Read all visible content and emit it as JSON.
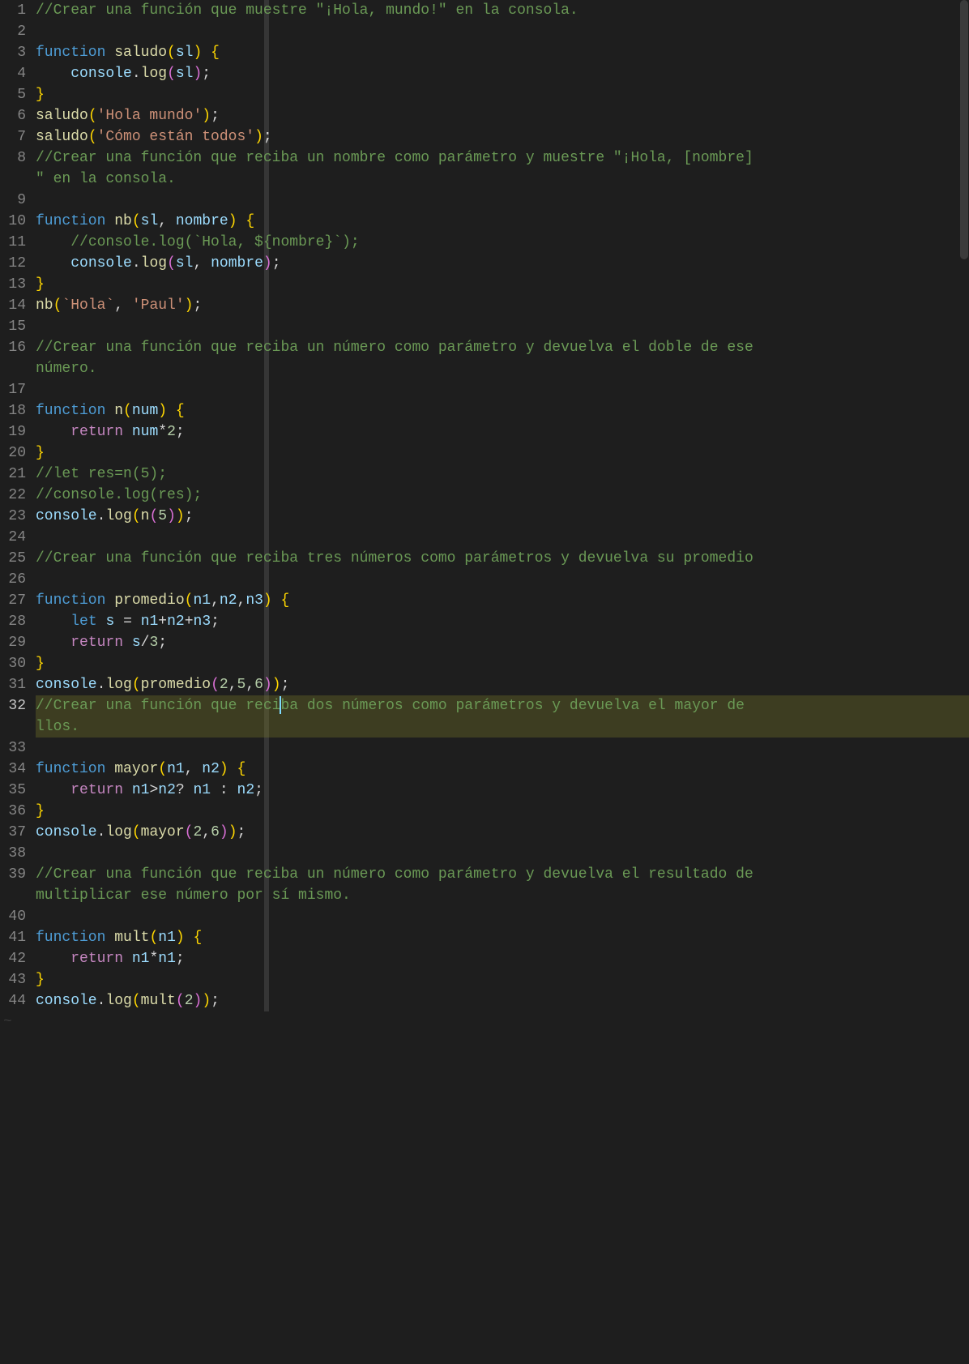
{
  "editor": {
    "activeLine": 32,
    "lines": [
      {
        "n": 1,
        "tokens": [
          [
            "comment",
            "//Crear una función que muestre \"¡Hola, mundo!\" en la consola."
          ]
        ]
      },
      {
        "n": 2,
        "tokens": []
      },
      {
        "n": 3,
        "tokens": [
          [
            "storage",
            "function"
          ],
          [
            "punc",
            " "
          ],
          [
            "func",
            "saludo"
          ],
          [
            "brace",
            "("
          ],
          [
            "param",
            "sl"
          ],
          [
            "brace",
            ")"
          ],
          [
            "punc",
            " "
          ],
          [
            "brace",
            "{"
          ]
        ]
      },
      {
        "n": 4,
        "tokens": [
          [
            "punc",
            "    "
          ],
          [
            "var",
            "console"
          ],
          [
            "punc",
            "."
          ],
          [
            "func",
            "log"
          ],
          [
            "brace2",
            "("
          ],
          [
            "var",
            "sl"
          ],
          [
            "brace2",
            ")"
          ],
          [
            "punc",
            ";"
          ]
        ]
      },
      {
        "n": 5,
        "tokens": [
          [
            "brace",
            "}"
          ]
        ]
      },
      {
        "n": 6,
        "tokens": [
          [
            "func",
            "saludo"
          ],
          [
            "brace",
            "("
          ],
          [
            "string",
            "'Hola mundo'"
          ],
          [
            "brace",
            ")"
          ],
          [
            "punc",
            ";"
          ]
        ]
      },
      {
        "n": 7,
        "tokens": [
          [
            "func",
            "saludo"
          ],
          [
            "brace",
            "("
          ],
          [
            "string",
            "'Cómo están todos'"
          ],
          [
            "brace",
            ")"
          ],
          [
            "punc",
            ";"
          ]
        ]
      },
      {
        "n": 8,
        "tokens": [
          [
            "comment",
            "//Crear una función que reciba un nombre como parámetro y muestre \"¡Hola, [nombre]"
          ]
        ]
      },
      {
        "n": 8,
        "wrap": true,
        "tokens": [
          [
            "comment",
            "\" en la consola."
          ]
        ]
      },
      {
        "n": 9,
        "tokens": []
      },
      {
        "n": 10,
        "tokens": [
          [
            "storage",
            "function"
          ],
          [
            "punc",
            " "
          ],
          [
            "func",
            "nb"
          ],
          [
            "brace",
            "("
          ],
          [
            "param",
            "sl"
          ],
          [
            "punc",
            ", "
          ],
          [
            "param",
            "nombre"
          ],
          [
            "brace",
            ")"
          ],
          [
            "punc",
            " "
          ],
          [
            "brace",
            "{"
          ]
        ]
      },
      {
        "n": 11,
        "tokens": [
          [
            "punc",
            "    "
          ],
          [
            "comment",
            "//console.log(`Hola, ${nombre}`);"
          ]
        ]
      },
      {
        "n": 12,
        "tokens": [
          [
            "punc",
            "    "
          ],
          [
            "var",
            "console"
          ],
          [
            "punc",
            "."
          ],
          [
            "func",
            "log"
          ],
          [
            "brace2",
            "("
          ],
          [
            "var",
            "sl"
          ],
          [
            "punc",
            ", "
          ],
          [
            "var",
            "nombre"
          ],
          [
            "brace2",
            ")"
          ],
          [
            "punc",
            ";"
          ]
        ]
      },
      {
        "n": 13,
        "tokens": [
          [
            "brace",
            "}"
          ]
        ]
      },
      {
        "n": 14,
        "tokens": [
          [
            "func",
            "nb"
          ],
          [
            "brace",
            "("
          ],
          [
            "string",
            "`Hola`"
          ],
          [
            "punc",
            ", "
          ],
          [
            "string",
            "'Paul'"
          ],
          [
            "brace",
            ")"
          ],
          [
            "punc",
            ";"
          ]
        ]
      },
      {
        "n": 15,
        "tokens": []
      },
      {
        "n": 16,
        "tokens": [
          [
            "comment",
            "//Crear una función que reciba un número como parámetro y devuelva el doble de ese"
          ]
        ]
      },
      {
        "n": 16,
        "wrap": true,
        "tokens": [
          [
            "comment",
            "número."
          ]
        ]
      },
      {
        "n": 17,
        "tokens": []
      },
      {
        "n": 18,
        "tokens": [
          [
            "storage",
            "function"
          ],
          [
            "punc",
            " "
          ],
          [
            "func",
            "n"
          ],
          [
            "brace",
            "("
          ],
          [
            "param",
            "num"
          ],
          [
            "brace",
            ")"
          ],
          [
            "punc",
            " "
          ],
          [
            "brace",
            "{"
          ]
        ]
      },
      {
        "n": 19,
        "tokens": [
          [
            "punc",
            "    "
          ],
          [
            "keyword",
            "return"
          ],
          [
            "punc",
            " "
          ],
          [
            "var",
            "num"
          ],
          [
            "op",
            "*"
          ],
          [
            "number",
            "2"
          ],
          [
            "punc",
            ";"
          ]
        ]
      },
      {
        "n": 20,
        "tokens": [
          [
            "brace",
            "}"
          ]
        ]
      },
      {
        "n": 21,
        "tokens": [
          [
            "comment",
            "//let res=n(5);"
          ]
        ]
      },
      {
        "n": 22,
        "tokens": [
          [
            "comment",
            "//console.log(res);"
          ]
        ]
      },
      {
        "n": 23,
        "tokens": [
          [
            "var",
            "console"
          ],
          [
            "punc",
            "."
          ],
          [
            "func",
            "log"
          ],
          [
            "brace",
            "("
          ],
          [
            "func",
            "n"
          ],
          [
            "brace2",
            "("
          ],
          [
            "number",
            "5"
          ],
          [
            "brace2",
            ")"
          ],
          [
            "brace",
            ")"
          ],
          [
            "punc",
            ";"
          ]
        ]
      },
      {
        "n": 24,
        "tokens": []
      },
      {
        "n": 25,
        "tokens": [
          [
            "comment",
            "//Crear una función que reciba tres números como parámetros y devuelva su promedio"
          ]
        ]
      },
      {
        "n": 26,
        "tokens": []
      },
      {
        "n": 27,
        "tokens": [
          [
            "storage",
            "function"
          ],
          [
            "punc",
            " "
          ],
          [
            "func",
            "promedio"
          ],
          [
            "brace",
            "("
          ],
          [
            "param",
            "n1"
          ],
          [
            "punc",
            ","
          ],
          [
            "param",
            "n2"
          ],
          [
            "punc",
            ","
          ],
          [
            "param",
            "n3"
          ],
          [
            "brace",
            ")"
          ],
          [
            "punc",
            " "
          ],
          [
            "brace",
            "{"
          ]
        ]
      },
      {
        "n": 28,
        "tokens": [
          [
            "punc",
            "    "
          ],
          [
            "storage",
            "let"
          ],
          [
            "punc",
            " "
          ],
          [
            "var",
            "s"
          ],
          [
            "punc",
            " "
          ],
          [
            "op",
            "="
          ],
          [
            "punc",
            " "
          ],
          [
            "var",
            "n1"
          ],
          [
            "op",
            "+"
          ],
          [
            "var",
            "n2"
          ],
          [
            "op",
            "+"
          ],
          [
            "var",
            "n3"
          ],
          [
            "punc",
            ";"
          ]
        ]
      },
      {
        "n": 29,
        "tokens": [
          [
            "punc",
            "    "
          ],
          [
            "keyword",
            "return"
          ],
          [
            "punc",
            " "
          ],
          [
            "var",
            "s"
          ],
          [
            "op",
            "/"
          ],
          [
            "number",
            "3"
          ],
          [
            "punc",
            ";"
          ]
        ]
      },
      {
        "n": 30,
        "tokens": [
          [
            "brace",
            "}"
          ]
        ]
      },
      {
        "n": 31,
        "tokens": [
          [
            "var",
            "console"
          ],
          [
            "punc",
            "."
          ],
          [
            "func",
            "log"
          ],
          [
            "brace",
            "("
          ],
          [
            "func",
            "promedio"
          ],
          [
            "brace2",
            "("
          ],
          [
            "number",
            "2"
          ],
          [
            "punc",
            ","
          ],
          [
            "number",
            "5"
          ],
          [
            "punc",
            ","
          ],
          [
            "number",
            "6"
          ],
          [
            "brace2",
            ")"
          ],
          [
            "brace",
            ")"
          ],
          [
            "punc",
            ";"
          ]
        ]
      },
      {
        "n": 32,
        "highlight": true,
        "cursorAfterToken": 0,
        "cursorInText": 28,
        "tokens": [
          [
            "comment",
            "//Crear una función que reciba dos números como parámetros y devuelva el mayor de "
          ]
        ]
      },
      {
        "n": 32,
        "wrap": true,
        "highlight": true,
        "tokens": [
          [
            "comment",
            "llos."
          ]
        ]
      },
      {
        "n": 33,
        "tokens": []
      },
      {
        "n": 34,
        "tokens": [
          [
            "storage",
            "function"
          ],
          [
            "punc",
            " "
          ],
          [
            "func",
            "mayor"
          ],
          [
            "brace",
            "("
          ],
          [
            "param",
            "n1"
          ],
          [
            "punc",
            ", "
          ],
          [
            "param",
            "n2"
          ],
          [
            "brace",
            ")"
          ],
          [
            "punc",
            " "
          ],
          [
            "brace",
            "{"
          ]
        ]
      },
      {
        "n": 35,
        "tokens": [
          [
            "punc",
            "    "
          ],
          [
            "keyword",
            "return"
          ],
          [
            "punc",
            " "
          ],
          [
            "var",
            "n1"
          ],
          [
            "op",
            ">"
          ],
          [
            "var",
            "n2"
          ],
          [
            "op",
            "?"
          ],
          [
            "punc",
            " "
          ],
          [
            "var",
            "n1"
          ],
          [
            "punc",
            " "
          ],
          [
            "op",
            ":"
          ],
          [
            "punc",
            " "
          ],
          [
            "var",
            "n2"
          ],
          [
            "punc",
            ";"
          ]
        ]
      },
      {
        "n": 36,
        "tokens": [
          [
            "brace",
            "}"
          ]
        ]
      },
      {
        "n": 37,
        "tokens": [
          [
            "var",
            "console"
          ],
          [
            "punc",
            "."
          ],
          [
            "func",
            "log"
          ],
          [
            "brace",
            "("
          ],
          [
            "func",
            "mayor"
          ],
          [
            "brace2",
            "("
          ],
          [
            "number",
            "2"
          ],
          [
            "punc",
            ","
          ],
          [
            "number",
            "6"
          ],
          [
            "brace2",
            ")"
          ],
          [
            "brace",
            ")"
          ],
          [
            "punc",
            ";"
          ]
        ]
      },
      {
        "n": 38,
        "tokens": []
      },
      {
        "n": 39,
        "tokens": [
          [
            "comment",
            "//Crear una función que reciba un número como parámetro y devuelva el resultado de"
          ]
        ]
      },
      {
        "n": 39,
        "wrap": true,
        "tokens": [
          [
            "comment",
            "multiplicar ese número por sí mismo."
          ]
        ]
      },
      {
        "n": 40,
        "tokens": []
      },
      {
        "n": 41,
        "tokens": [
          [
            "storage",
            "function"
          ],
          [
            "punc",
            " "
          ],
          [
            "func",
            "mult"
          ],
          [
            "brace",
            "("
          ],
          [
            "param",
            "n1"
          ],
          [
            "brace",
            ")"
          ],
          [
            "punc",
            " "
          ],
          [
            "brace",
            "{"
          ]
        ]
      },
      {
        "n": 42,
        "tokens": [
          [
            "punc",
            "    "
          ],
          [
            "keyword",
            "return"
          ],
          [
            "punc",
            " "
          ],
          [
            "var",
            "n1"
          ],
          [
            "op",
            "*"
          ],
          [
            "var",
            "n1"
          ],
          [
            "punc",
            ";"
          ]
        ]
      },
      {
        "n": 43,
        "tokens": [
          [
            "brace",
            "}"
          ]
        ]
      },
      {
        "n": 44,
        "tokens": [
          [
            "var",
            "console"
          ],
          [
            "punc",
            "."
          ],
          [
            "func",
            "log"
          ],
          [
            "brace",
            "("
          ],
          [
            "func",
            "mult"
          ],
          [
            "brace2",
            "("
          ],
          [
            "number",
            "2"
          ],
          [
            "brace2",
            ")"
          ],
          [
            "brace",
            ")"
          ],
          [
            "punc",
            ";"
          ]
        ]
      }
    ],
    "tildeLines": 1,
    "tokenClassMap": {
      "comment": "tok-comment",
      "keyword": "tok-keyword",
      "storage": "tok-storage",
      "func": "tok-func",
      "var": "tok-var",
      "param": "tok-param",
      "obj": "tok-obj",
      "string": "tok-string",
      "number": "tok-number",
      "punc": "tok-punc",
      "brace": "tok-brace",
      "brace2": "tok-brace2",
      "op": "tok-op"
    }
  }
}
